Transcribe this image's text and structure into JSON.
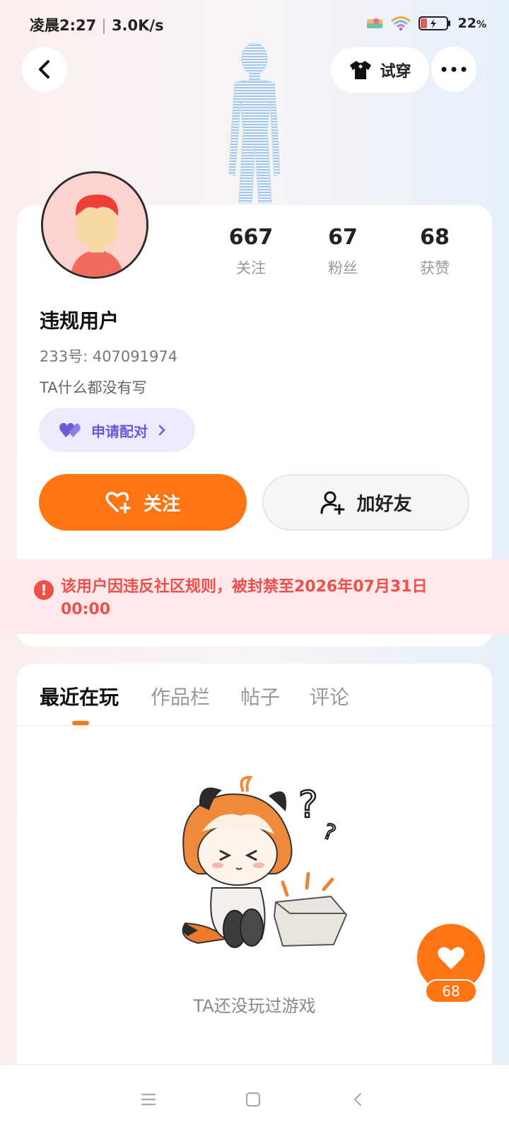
{
  "status_bar": {
    "time": "凌晨2:27",
    "speed": "3.0K/s",
    "battery": "22",
    "battery_unit": "%"
  },
  "header": {
    "try_on_label": "试穿"
  },
  "profile": {
    "username": "违规用户",
    "id_text": "233号: 407091974",
    "bio": "TA什么都没有写",
    "stats": [
      {
        "value": "667",
        "label": "关注"
      },
      {
        "value": "67",
        "label": "粉丝"
      },
      {
        "value": "68",
        "label": "获赞"
      }
    ],
    "pair_label": "申请配对",
    "follow_label": "关注",
    "add_friend_label": "加好友"
  },
  "ban_notice": "该用户因违反社区规则，被封禁至2026年07月31日 00:00",
  "tabs": [
    {
      "label": "最近在玩",
      "active": true
    },
    {
      "label": "作品栏",
      "active": false
    },
    {
      "label": "帖子",
      "active": false
    },
    {
      "label": "评论",
      "active": false
    }
  ],
  "empty_state": {
    "text": "TA还没玩过游戏"
  },
  "like_fab": {
    "count": "68"
  },
  "colors": {
    "accent": "#ff7413",
    "ban_text": "#ef4f4a",
    "pair_purple": "#6a5bd6"
  }
}
